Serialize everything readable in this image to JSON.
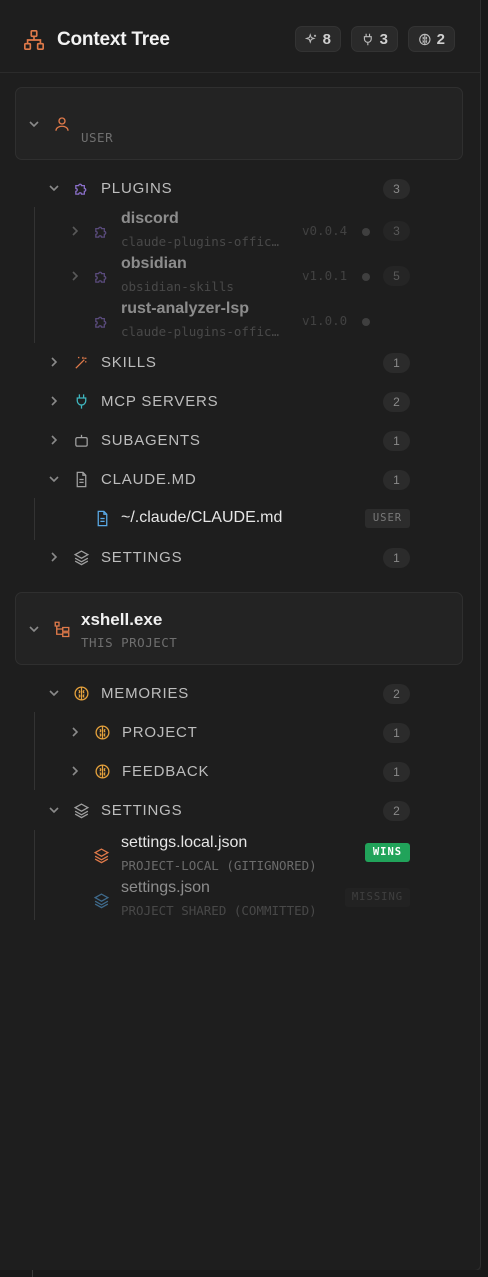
{
  "header": {
    "title": "Context Tree",
    "stats": [
      {
        "icon": "sparkles-icon",
        "value": "8"
      },
      {
        "icon": "plug-icon",
        "value": "3"
      },
      {
        "icon": "brain-icon",
        "value": "2"
      }
    ]
  },
  "user_scope": {
    "name": "",
    "subtitle": "USER",
    "plugins": {
      "label": "PLUGINS",
      "count": "3",
      "items": [
        {
          "name": "discord",
          "source": "claude-plugins-official",
          "version": "v0.0.4",
          "count": "3"
        },
        {
          "name": "obsidian",
          "source": "obsidian-skills",
          "version": "v1.0.1",
          "count": "5"
        },
        {
          "name": "rust-analyzer-lsp",
          "source": "claude-plugins-official",
          "version": "v1.0.0"
        }
      ]
    },
    "skills": {
      "label": "SKILLS",
      "count": "1"
    },
    "mcp_servers": {
      "label": "MCP SERVERS",
      "count": "2"
    },
    "subagents": {
      "label": "SUBAGENTS",
      "count": "1"
    },
    "claude_md": {
      "label": "CLAUDE.MD",
      "count": "1",
      "file": {
        "name": "~/.claude/CLAUDE.md",
        "tag": "USER"
      }
    },
    "settings": {
      "label": "SETTINGS",
      "count": "1"
    }
  },
  "project_scope": {
    "name": "xshell.exe",
    "subtitle": "THIS PROJECT",
    "memories": {
      "label": "MEMORIES",
      "count": "2",
      "items": [
        {
          "label": "PROJECT",
          "count": "1"
        },
        {
          "label": "FEEDBACK",
          "count": "1"
        }
      ]
    },
    "settings": {
      "label": "SETTINGS",
      "count": "2",
      "files": [
        {
          "name": "settings.local.json",
          "sub": "PROJECT-LOCAL (GITIGNORED)",
          "tag": "WINS"
        },
        {
          "name": "settings.json",
          "sub": "PROJECT SHARED (COMMITTED)",
          "tag": "MISSING"
        }
      ]
    }
  },
  "colors": {
    "accent": "#e07a4a",
    "plugin": "#8a6fc8",
    "mcp": "#3fb7c0",
    "memory": "#e6a23c",
    "wins": "#21a35a"
  }
}
